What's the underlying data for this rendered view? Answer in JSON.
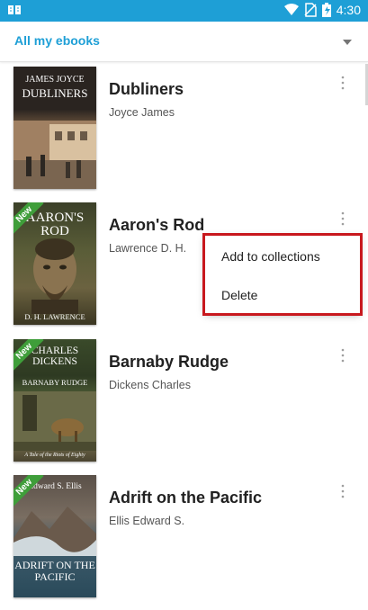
{
  "status_bar": {
    "time": "4:30",
    "icons": [
      "book-icon",
      "wifi-icon",
      "no-sim-icon",
      "battery-icon"
    ],
    "accent": "#1e9fd6"
  },
  "toolbar": {
    "title": "All my ebooks",
    "icon": "dropdown-arrow-icon"
  },
  "books": [
    {
      "title": "Dubliners",
      "author": "Joyce James",
      "new": false,
      "cover": {
        "top": "JAMES JOYCE",
        "main": "DUBLINERS",
        "bottom": ""
      }
    },
    {
      "title": "Aaron's Rod",
      "author": "Lawrence D. H.",
      "new": true,
      "cover": {
        "top": "",
        "main": "AARON'S ROD",
        "bottom": "D. H. LAWRENCE"
      }
    },
    {
      "title": "Barnaby Rudge",
      "author": "Dickens Charles",
      "new": true,
      "cover": {
        "top": "CHARLES DICKENS",
        "main": "BARNABY RUDGE",
        "bottom": "A Tale of the Riots of Eighty"
      }
    },
    {
      "title": "Adrift on the Pacific",
      "author": "Ellis Edward S.",
      "new": true,
      "cover": {
        "top": "Edward S. Ellis",
        "main": "ADRIFT ON the PACIFIC",
        "bottom": ""
      }
    }
  ],
  "new_badge": "New",
  "context_menu": {
    "items": [
      "Add to collections",
      "Delete"
    ],
    "highlight_color": "#c8181e"
  }
}
